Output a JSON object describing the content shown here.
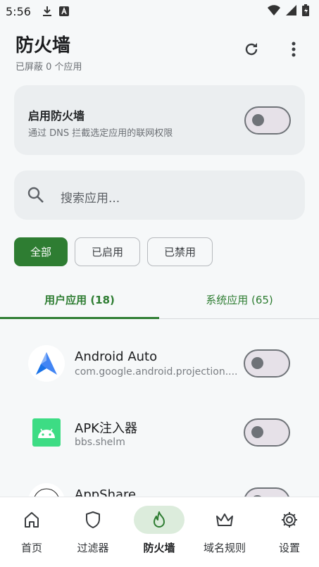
{
  "status_bar": {
    "time": "5:56",
    "icons": [
      "download-icon",
      "a-box-icon",
      "wifi-icon",
      "signal-icon",
      "battery-icon"
    ]
  },
  "header": {
    "title": "防火墙",
    "subtitle": "已屏蔽 0 个应用",
    "actions": [
      "refresh-icon",
      "more-vert-icon"
    ]
  },
  "firewall_card": {
    "label": "启用防火墙",
    "description": "通过 DNS 拦截选定应用的联网权限",
    "enabled": false
  },
  "search": {
    "placeholder": "搜索应用..."
  },
  "filters": [
    {
      "label": "全部",
      "selected": true
    },
    {
      "label": "已启用",
      "selected": false
    },
    {
      "label": "已禁用",
      "selected": false
    }
  ],
  "tabs": [
    {
      "label": "用户应用 (18)",
      "selected": true
    },
    {
      "label": "系统应用 (65)",
      "selected": false
    }
  ],
  "apps": [
    {
      "name": "Android Auto",
      "package": "com.google.android.projection....",
      "enabled": false,
      "icon": "android-auto-icon"
    },
    {
      "name": "APK注入器",
      "package": "bbs.shelm",
      "enabled": false,
      "icon": "android-robot-icon"
    },
    {
      "name": "AppShare",
      "package": "",
      "enabled": false,
      "icon": "appshare-icon"
    }
  ],
  "bottom_nav": [
    {
      "label": "首页",
      "icon": "home-icon",
      "selected": false
    },
    {
      "label": "过滤器",
      "icon": "shield-icon",
      "selected": false
    },
    {
      "label": "防火墙",
      "icon": "fire-icon",
      "selected": true
    },
    {
      "label": "域名规则",
      "icon": "crown-icon",
      "selected": false
    },
    {
      "label": "设置",
      "icon": "gear-icon",
      "selected": false
    }
  ],
  "colors": {
    "accent": "#2e7d32",
    "card": "#ebeef0",
    "background": "#f6f8f9",
    "nav_pill": "#dcecdc"
  }
}
